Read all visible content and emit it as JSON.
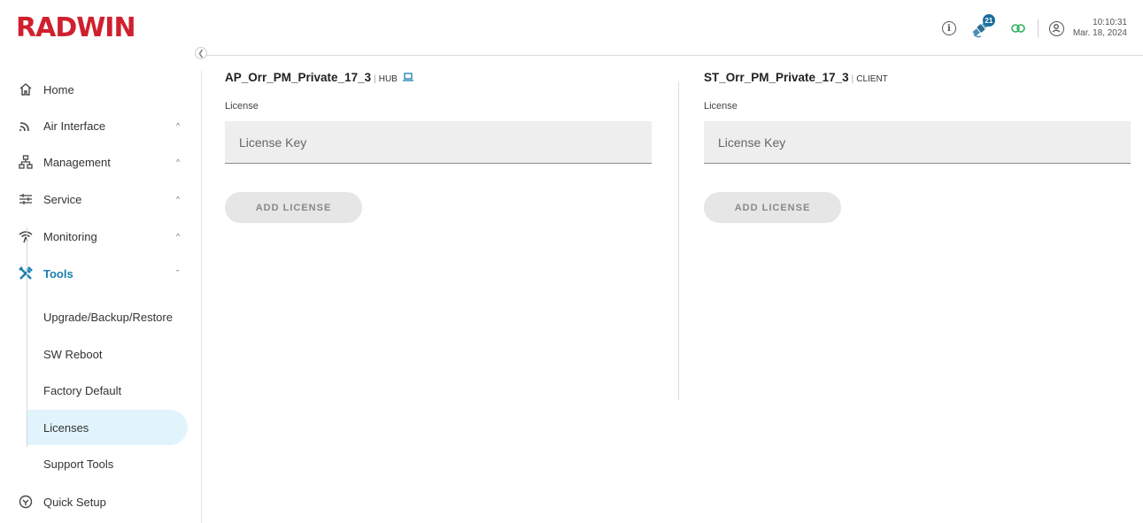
{
  "brand": {
    "logo_text": "RADWIN",
    "logo_color": "#d0202e"
  },
  "header": {
    "notification_count": "21",
    "time": "10:10:31",
    "date": "Mar. 18, 2024",
    "icons": [
      "info-icon",
      "satellite-icon",
      "link-icon",
      "user-icon"
    ]
  },
  "sidebar": {
    "collapse_icon": "chevron-left-icon",
    "items": [
      {
        "label": "Home",
        "icon": "home-icon"
      },
      {
        "label": "Air Interface",
        "icon": "wifi-arc-icon",
        "chevron": "^"
      },
      {
        "label": "Management",
        "icon": "network-icon",
        "chevron": "^"
      },
      {
        "label": "Service",
        "icon": "sliders-icon",
        "chevron": "^"
      },
      {
        "label": "Monitoring",
        "icon": "signal-icon",
        "chevron": "^"
      },
      {
        "label": "Tools",
        "icon": "tools-icon",
        "chevron": "ˇ"
      },
      {
        "label": "Quick Setup",
        "icon": "quick-setup-icon"
      }
    ],
    "tools_sub": [
      {
        "label": "Upgrade/Backup/Restore"
      },
      {
        "label": "SW Reboot"
      },
      {
        "label": "Factory Default"
      },
      {
        "label": "Licenses"
      },
      {
        "label": "Support Tools"
      }
    ],
    "accent_color": "#1a7fb0",
    "selected_bg": "#e1f4fb"
  },
  "hub": {
    "name": "AP_Orr_PM_Private_17_3",
    "separator": "|",
    "role": "HUB",
    "section_label": "License",
    "key_placeholder": "License Key",
    "button": "ADD LICENSE"
  },
  "client": {
    "name": "ST_Orr_PM_Private_17_3",
    "separator": "|",
    "role": "CLIENT",
    "section_label": "License",
    "key_placeholder": "License Key",
    "button": "ADD LICENSE"
  }
}
